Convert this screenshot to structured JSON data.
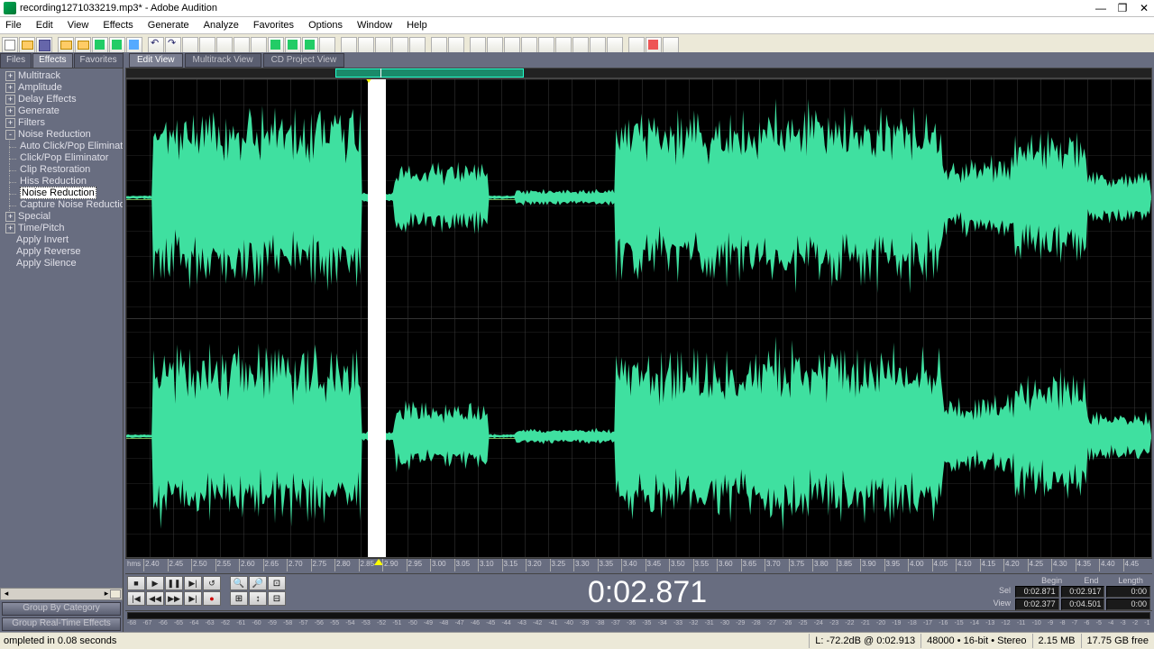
{
  "title": "recording1271033219.mp3* - Adobe Audition",
  "menu": [
    "File",
    "Edit",
    "View",
    "Effects",
    "Generate",
    "Analyze",
    "Favorites",
    "Options",
    "Window",
    "Help"
  ],
  "side_tabs": [
    "Files",
    "Effects",
    "Favorites"
  ],
  "side_active": 1,
  "tree": [
    {
      "label": "Multitrack",
      "box": "+",
      "child": false
    },
    {
      "label": "Amplitude",
      "box": "+",
      "child": false
    },
    {
      "label": "Delay Effects",
      "box": "+",
      "child": false
    },
    {
      "label": "Generate",
      "box": "+",
      "child": false
    },
    {
      "label": "Filters",
      "box": "+",
      "child": false
    },
    {
      "label": "Noise Reduction",
      "box": "-",
      "child": false
    },
    {
      "label": "Auto Click/Pop Eliminator",
      "box": "",
      "child": true
    },
    {
      "label": "Click/Pop Eliminator",
      "box": "",
      "child": true
    },
    {
      "label": "Clip Restoration",
      "box": "",
      "child": true
    },
    {
      "label": "Hiss Reduction",
      "box": "",
      "child": true
    },
    {
      "label": "Noise Reduction",
      "box": "",
      "child": true,
      "selected": true
    },
    {
      "label": "Capture Noise Reduction Profile",
      "box": "",
      "child": true
    },
    {
      "label": "Special",
      "box": "+",
      "child": false
    },
    {
      "label": "Time/Pitch",
      "box": "+",
      "child": false
    },
    {
      "label": "Apply Invert",
      "box": "",
      "child": false,
      "leaf": true
    },
    {
      "label": "Apply Reverse",
      "box": "",
      "child": false,
      "leaf": true
    },
    {
      "label": "Apply Silence",
      "box": "",
      "child": false,
      "leaf": true
    }
  ],
  "side_btns": [
    "Group By Category",
    "Group Real-Time Effects"
  ],
  "view_tabs": [
    "Edit View",
    "Multitrack View",
    "CD Project View"
  ],
  "view_active": 0,
  "bigtime": "0:02.871",
  "ruler_hms": "hms",
  "ticks": [
    "2.40",
    "2.45",
    "2.50",
    "2.55",
    "2.60",
    "2.65",
    "2.70",
    "2.75",
    "2.80",
    "2.85",
    "2.90",
    "2.95",
    "3.00",
    "3.05",
    "3.10",
    "3.15",
    "3.20",
    "3.25",
    "3.30",
    "3.35",
    "3.40",
    "3.45",
    "3.50",
    "3.55",
    "3.60",
    "3.65",
    "3.70",
    "3.75",
    "3.80",
    "3.85",
    "3.90",
    "3.95",
    "4.00",
    "4.05",
    "4.10",
    "4.15",
    "4.20",
    "4.25",
    "4.30",
    "4.35",
    "4.40",
    "4.45"
  ],
  "sel_header": [
    "Begin",
    "End",
    "Length"
  ],
  "sel_row": {
    "label": "Sel",
    "begin": "0:02.871",
    "end": "0:02.917",
    "len": "0:00"
  },
  "view_row": {
    "label": "View",
    "begin": "0:02.377",
    "end": "0:04.501",
    "len": "0:00"
  },
  "level_scale": [
    "-68",
    "-67",
    "-66",
    "-65",
    "-64",
    "-63",
    "-62",
    "-61",
    "-60",
    "-59",
    "-58",
    "-57",
    "-56",
    "-55",
    "-54",
    "-53",
    "-52",
    "-51",
    "-50",
    "-49",
    "-48",
    "-47",
    "-46",
    "-45",
    "-44",
    "-43",
    "-42",
    "-41",
    "-40",
    "-39",
    "-38",
    "-37",
    "-36",
    "-35",
    "-34",
    "-33",
    "-32",
    "-31",
    "-30",
    "-29",
    "-28",
    "-27",
    "-26",
    "-25",
    "-24",
    "-23",
    "-22",
    "-21",
    "-20",
    "-19",
    "-18",
    "-17",
    "-16",
    "-15",
    "-14",
    "-13",
    "-12",
    "-11",
    "-10",
    "-9",
    "-8",
    "-7",
    "-6",
    "-5",
    "-4",
    "-3",
    "-2",
    "-1"
  ],
  "status": {
    "msg": "ompleted in 0.08 seconds",
    "db": "L: -72.2dB @ 0:02.913",
    "rate": "48000 • 16-bit • Stereo",
    "size": "2.15 MB",
    "free": "17.75 GB free"
  }
}
